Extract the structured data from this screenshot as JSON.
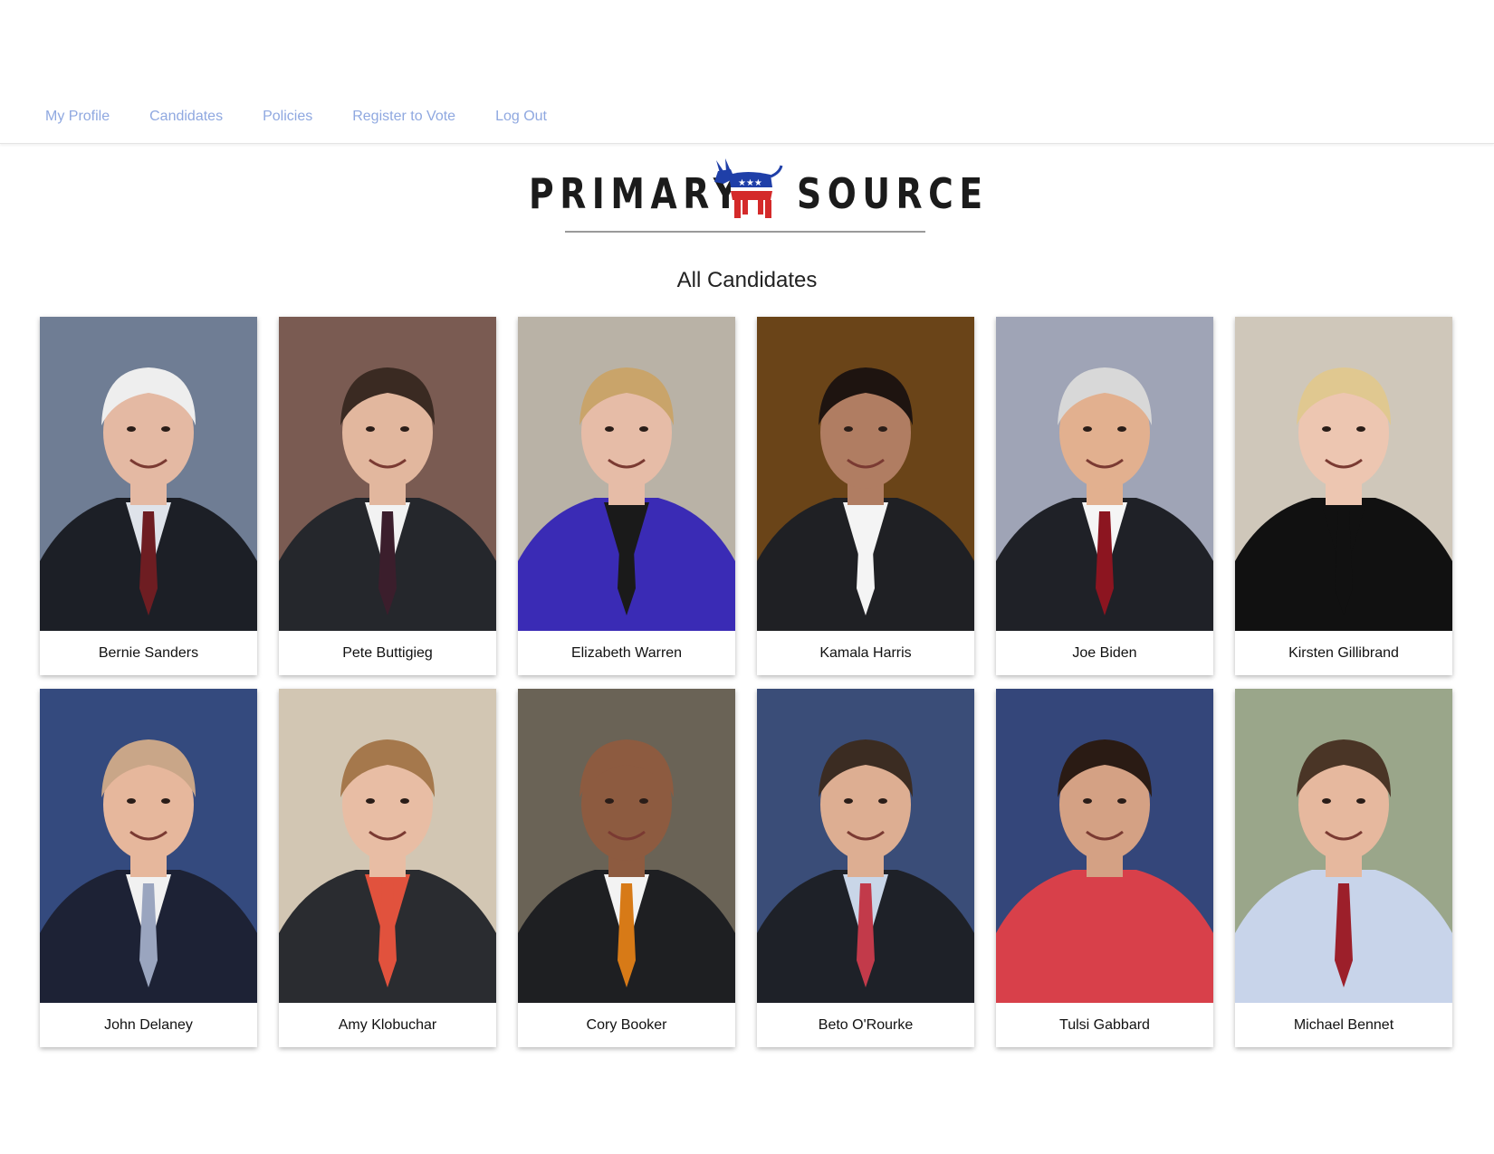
{
  "nav": {
    "items": [
      {
        "label": "My Profile"
      },
      {
        "label": "Candidates"
      },
      {
        "label": "Policies"
      },
      {
        "label": "Register to Vote"
      },
      {
        "label": "Log Out"
      }
    ],
    "link_color": "#8fa8e0"
  },
  "logo": {
    "left_word": "PRIMARY",
    "right_word": "SOURCE",
    "icon": "democratic-donkey-icon"
  },
  "heading": "All Candidates",
  "candidates": [
    {
      "name": "Bernie Sanders",
      "bg": "#6f7d94",
      "suit": "#1c1f26",
      "shirt": "#dfe3ea",
      "tie": "#6e1d22",
      "skin": "#e4b9a3",
      "hair": "#eeeeee"
    },
    {
      "name": "Pete Buttigieg",
      "bg": "#7a5b52",
      "suit": "#25272c",
      "shirt": "#f2f2f2",
      "tie": "#3b1e2c",
      "skin": "#e2b79e",
      "hair": "#3a2a22"
    },
    {
      "name": "Elizabeth Warren",
      "bg": "#b9b2a6",
      "suit": "#3a2bb5",
      "shirt": "#1a1a1a",
      "tie": "#1a1a1a",
      "skin": "#e6bca7",
      "hair": "#c9a46a"
    },
    {
      "name": "Kamala Harris",
      "bg": "#6a4418",
      "suit": "#1f2024",
      "shirt": "#f4f4f4",
      "tie": "#f4f4f4",
      "skin": "#b07d62",
      "hair": "#1e1410"
    },
    {
      "name": "Joe Biden",
      "bg": "#9fa4b6",
      "suit": "#1f2127",
      "shirt": "#f5f5f5",
      "tie": "#8c1520",
      "skin": "#e2b08f",
      "hair": "#d8d8d8"
    },
    {
      "name": "Kirsten Gillibrand",
      "bg": "#cfc7ba",
      "suit": "#111111",
      "shirt": "#111111",
      "tie": "#111111",
      "skin": "#edc6b1",
      "hair": "#e0c890"
    },
    {
      "name": "John Delaney",
      "bg": "#344a7e",
      "suit": "#1d2235",
      "shirt": "#f1f1f1",
      "tie": "#9aa5bf",
      "skin": "#e6b79c",
      "hair": "#c9a688"
    },
    {
      "name": "Amy Klobuchar",
      "bg": "#d2c6b3",
      "suit": "#2a2c30",
      "shirt": "#e1523d",
      "tie": "#e1523d",
      "skin": "#e8bda4",
      "hair": "#a5784c"
    },
    {
      "name": "Cory Booker",
      "bg": "#6a6356",
      "suit": "#1e1f22",
      "shirt": "#f3f3f3",
      "tie": "#d77a17",
      "skin": "#8d5b40",
      "hair": "#8d5b40"
    },
    {
      "name": "Beto O'Rourke",
      "bg": "#3a4d78",
      "suit": "#1e2128",
      "shirt": "#c9d6e8",
      "tie": "#c23a4a",
      "skin": "#ddae92",
      "hair": "#3b2c22"
    },
    {
      "name": "Tulsi Gabbard",
      "bg": "#34467a",
      "suit": "#d8404a",
      "shirt": "#d8404a",
      "tie": "#d8404a",
      "skin": "#d4a184",
      "hair": "#2a1b14"
    },
    {
      "name": "Michael Bennet",
      "bg": "#9aa68a",
      "suit": "#c8d4ea",
      "shirt": "#c8d4ea",
      "tie": "#9c1f2a",
      "skin": "#e6b89e",
      "hair": "#4a3526"
    }
  ]
}
